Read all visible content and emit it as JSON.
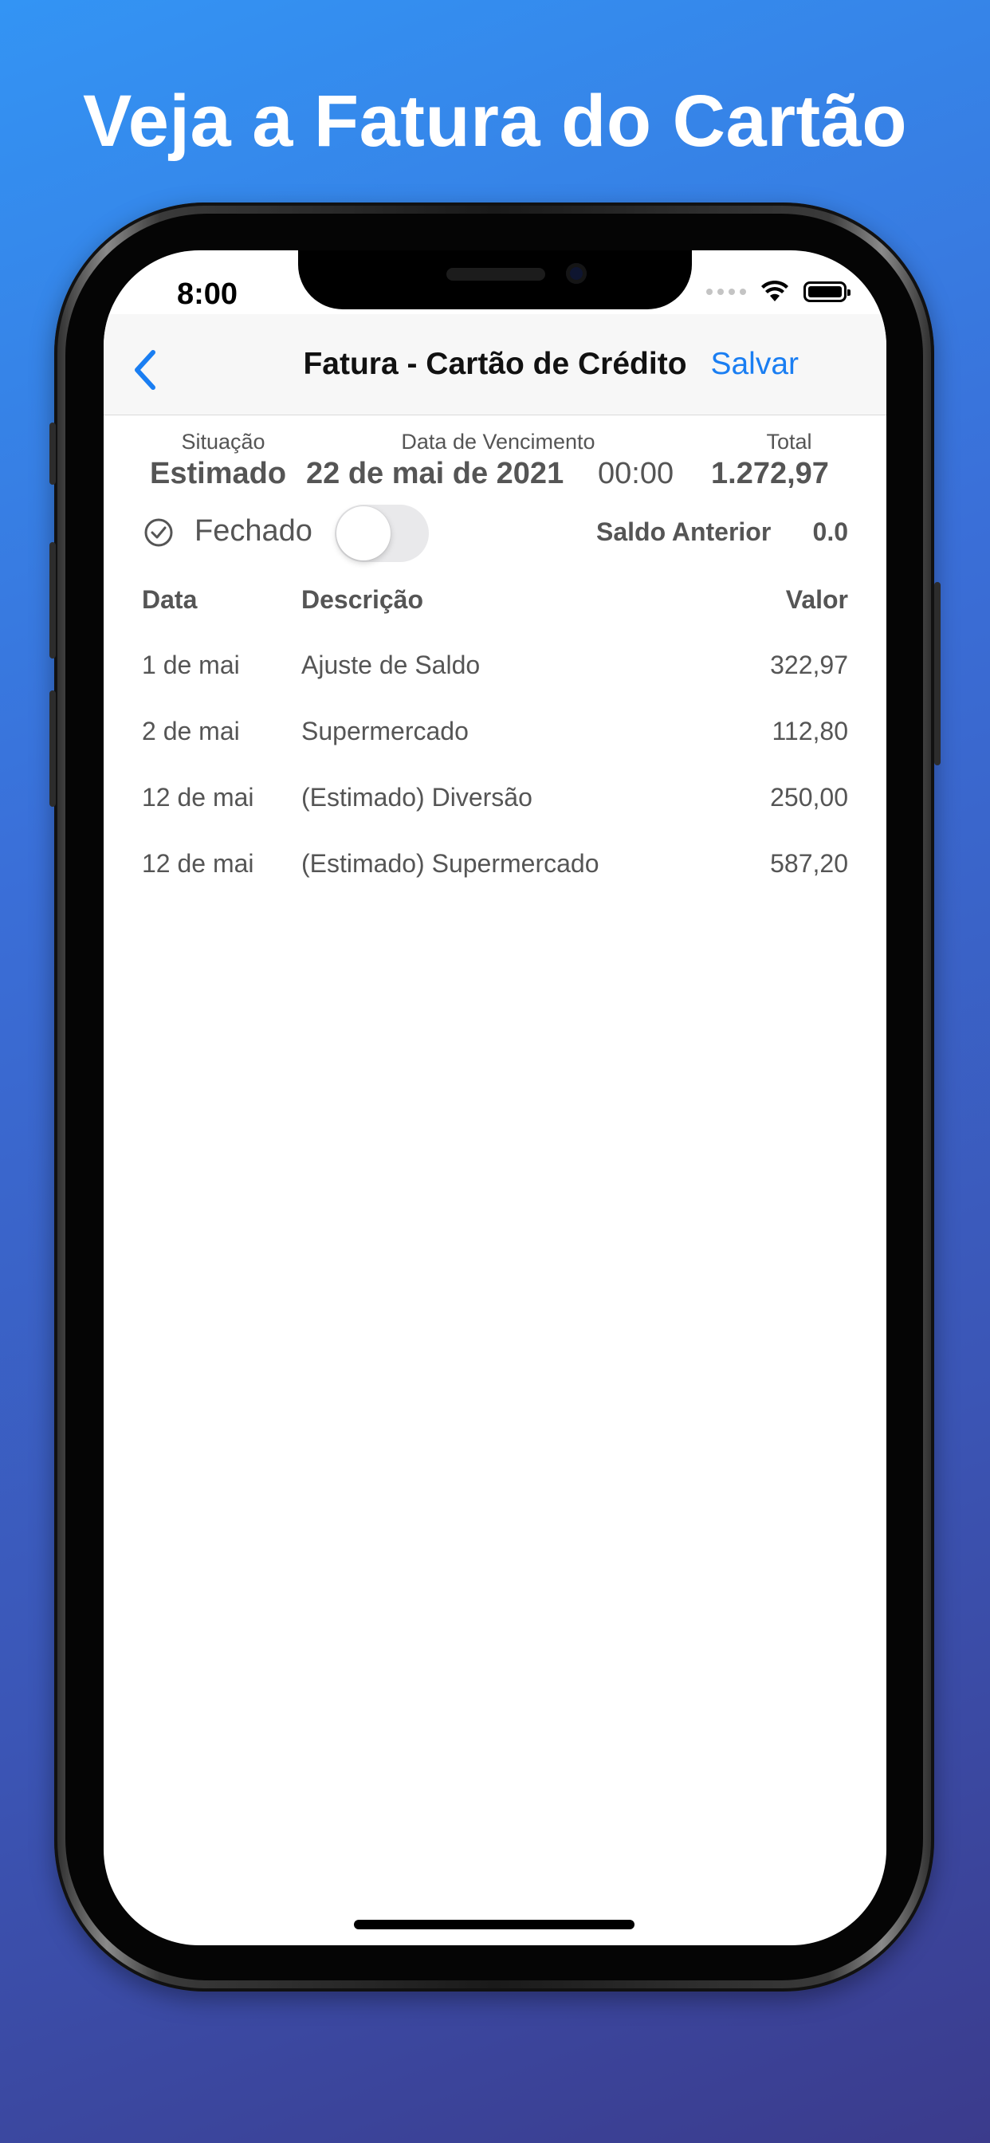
{
  "promo": {
    "title": "Veja a Fatura do Cartão"
  },
  "status_bar": {
    "time": "8:00"
  },
  "navbar": {
    "back_icon": "chevron-left-icon",
    "title": "Fatura - Cartão de Crédito",
    "save_label": "Salvar",
    "accent_color": "#1a7ef2"
  },
  "summary": {
    "situation_label": "Situação",
    "situation_value": "Estimado",
    "due_label": "Data de Vencimento",
    "due_date": "22 de mai de 2021",
    "due_time": "00:00",
    "total_label": "Total",
    "total_value": "1.272,97"
  },
  "closed": {
    "icon": "check-circle-icon",
    "label": "Fechado",
    "toggle_on": false
  },
  "previous_balance": {
    "label": "Saldo Anterior",
    "value": "0.0"
  },
  "table": {
    "headers": {
      "date": "Data",
      "description": "Descrição",
      "value": "Valor"
    },
    "rows": [
      {
        "date": "1 de mai",
        "description": "Ajuste de Saldo",
        "value": "322,97"
      },
      {
        "date": "2 de mai",
        "description": "Supermercado",
        "value": "112,80"
      },
      {
        "date": "12 de mai",
        "description": "(Estimado) Diversão",
        "value": "250,00"
      },
      {
        "date": "12 de mai",
        "description": "(Estimado) Supermercado",
        "value": "587,20"
      }
    ]
  }
}
